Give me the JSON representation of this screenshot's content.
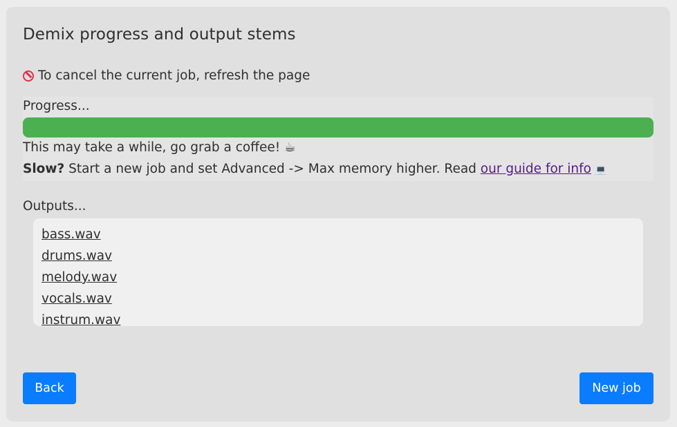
{
  "page": {
    "title": "Demix progress and output stems",
    "cancel_text": "To cancel the current job, refresh the page",
    "cancel_icon": "no-entry-icon"
  },
  "progress": {
    "label": "Progress...",
    "value_percent": 100,
    "bar_color": "#4caf50",
    "wait_text": "This may take a while, go grab a coffee! ☕",
    "slow_bold": "Slow?",
    "slow_text": " Start a new job and set Advanced -> Max memory higher. Read ",
    "guide_link": "our guide for info",
    "guide_icon": "💻"
  },
  "outputs": {
    "label": "Outputs...",
    "files": [
      "bass.wav",
      "drums.wav",
      "melody.wav",
      "vocals.wav",
      "instrum.wav"
    ]
  },
  "buttons": {
    "back": "Back",
    "new_job": "New job",
    "color": "#0a7cff"
  }
}
